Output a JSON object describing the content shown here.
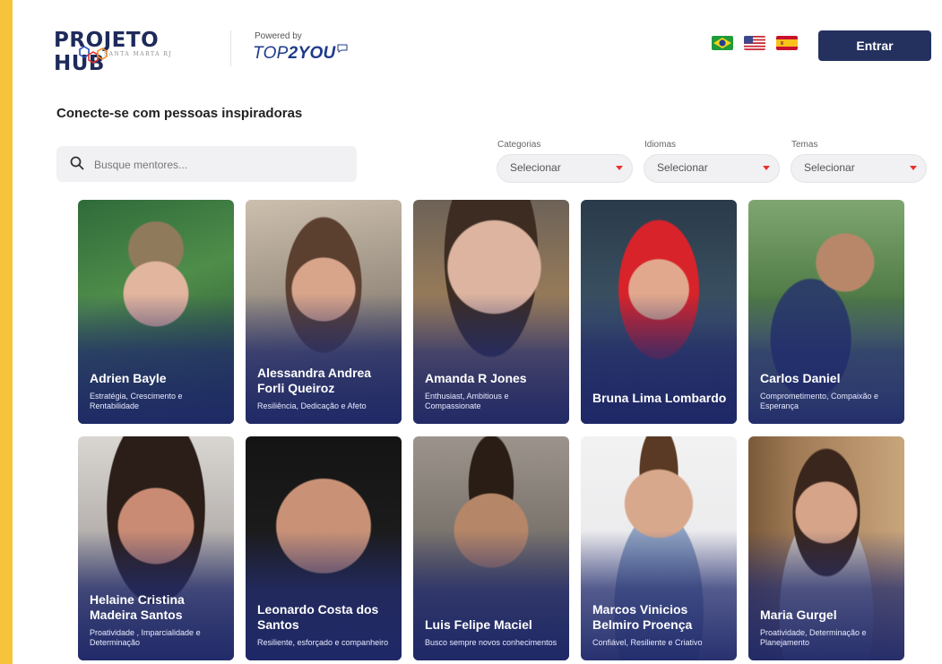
{
  "header": {
    "logo_title": "PROJETO HUB",
    "logo_subtitle": "SANTA MARTA RJ",
    "powered_label": "Powered by",
    "powered_brand_light": "TOP",
    "powered_brand_bold": "2YOU",
    "flags": [
      "brazil-flag-icon",
      "usa-flag-icon",
      "spain-flag-icon"
    ],
    "login_label": "Entrar"
  },
  "section_title": "Conecte-se com pessoas inspiradoras",
  "search": {
    "placeholder": "Busque mentores..."
  },
  "filters": [
    {
      "label": "Categorias",
      "value": "Selecionar"
    },
    {
      "label": "Idiomas",
      "value": "Selecionar"
    },
    {
      "label": "Temas",
      "value": "Selecionar"
    }
  ],
  "colors": {
    "primary": "#24305e",
    "accent": "#e5322d",
    "frame": "#f6c43a",
    "card_overlay": "#222c6e"
  },
  "mentors": [
    {
      "name": "Adrien Bayle",
      "tags": "Estratégia, Crescimento e Rentabilidade"
    },
    {
      "name": "Alessandra Andrea Forli Queiroz",
      "tags": "Resiliência, Dedicação e Afeto"
    },
    {
      "name": "Amanda R Jones",
      "tags": "Enthusiast, Ambitious e Compassionate"
    },
    {
      "name": "Bruna Lima Lombardo",
      "tags": ""
    },
    {
      "name": "Carlos Daniel",
      "tags": "Comprometimento, Compaixão e Esperança"
    },
    {
      "name": "Helaine Cristina Madeira Santos",
      "tags": "Proatividade , Imparcialidade e Determinação"
    },
    {
      "name": "Leonardo Costa dos Santos",
      "tags": "Resiliente, esforçado e companheiro"
    },
    {
      "name": "Luis Felipe Maciel",
      "tags": "Busco sempre novos conhecimentos"
    },
    {
      "name": "Marcos Vinicios Belmiro Proença",
      "tags": "Confiável, Resiliente e Criativo"
    },
    {
      "name": "Maria Gurgel",
      "tags": "Proatividade, Determinação e Planejamento"
    }
  ]
}
